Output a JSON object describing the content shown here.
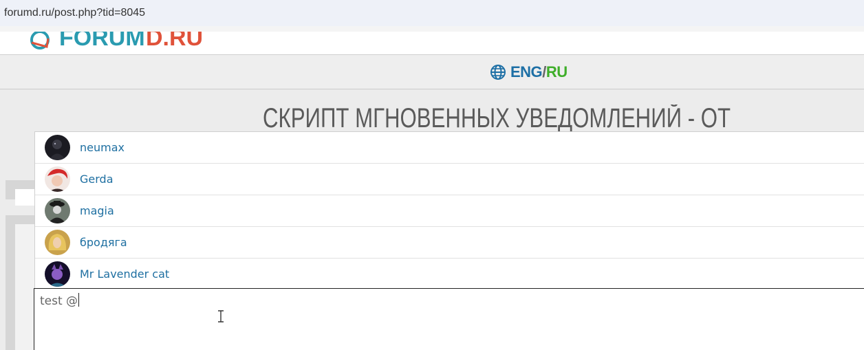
{
  "browser": {
    "url": "forumd.ru/post.php?tid=8045"
  },
  "header": {
    "logo_text": "FORUMD.RU"
  },
  "language": {
    "icon": "globe-icon",
    "eng": "ENG",
    "separator": "/",
    "ru": "RU",
    "eng_color": "#1d6fa5",
    "ru_color": "#3fae2a"
  },
  "page": {
    "title": "СКРИПТ МГНОВЕННЫХ УВЕДОМЛЕНИЙ - ОТВЕТИТЬ"
  },
  "mention_dropdown": {
    "users": [
      {
        "name": "neumax"
      },
      {
        "name": "Gerda"
      },
      {
        "name": "magia"
      },
      {
        "name": "бродяга"
      },
      {
        "name": "Mr Lavender cat"
      }
    ]
  },
  "editor": {
    "text": "test @"
  }
}
